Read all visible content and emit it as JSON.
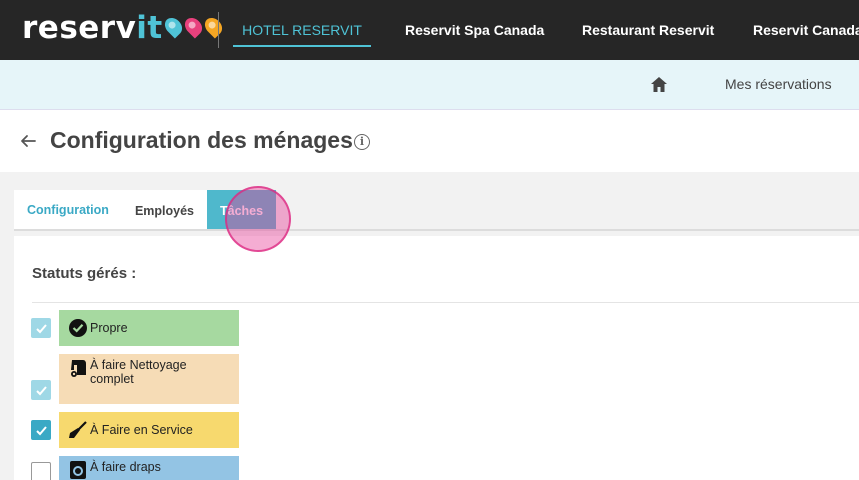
{
  "brand": {
    "name_part1": "reserv",
    "name_part2": "it"
  },
  "topnav": {
    "items": [
      {
        "label": "HOTEL RESERVIT"
      },
      {
        "label": "Reservit Spa Canada"
      },
      {
        "label": "Restaurant Reservit"
      },
      {
        "label": "Reservit Canada"
      }
    ]
  },
  "subbar": {
    "link": "Mes réservations"
  },
  "page": {
    "title": "Configuration des ménages",
    "info": "i"
  },
  "tabs": [
    {
      "label": "Configuration"
    },
    {
      "label": "Employés"
    },
    {
      "label": "Tâches"
    }
  ],
  "section": {
    "title": "Statuts gérés :"
  },
  "statuses": [
    {
      "label": "Propre",
      "checked": true,
      "color": "#a6d9a0",
      "icon": "check-circle-icon"
    },
    {
      "label": "À faire Nettoyage complet",
      "checked": true,
      "color": "#f6dcb6",
      "icon": "vacuum-icon"
    },
    {
      "label": "À Faire en Service",
      "checked": true,
      "color": "#f7d96e",
      "icon": "broom-icon"
    },
    {
      "label": "À faire draps",
      "checked": false,
      "color": "#93c4e4",
      "icon": "washing-machine-icon"
    }
  ],
  "colors": {
    "accent": "#4fc3d6",
    "navbar": "#262626",
    "subbar": "#e6f5f9"
  }
}
